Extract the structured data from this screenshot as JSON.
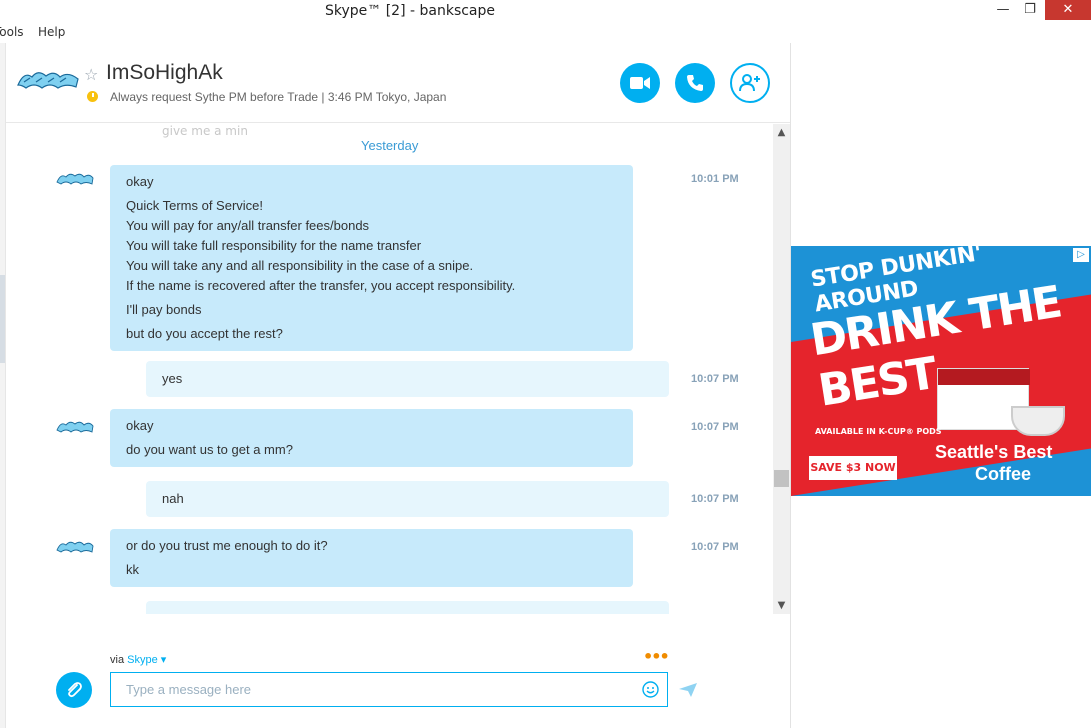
{
  "window": {
    "title": "Skype™ [2] - bankscape",
    "minimize": "—",
    "maximize": "❐",
    "close": "✕"
  },
  "menu": {
    "items": [
      "Tools",
      "Help"
    ]
  },
  "contact": {
    "name": "ImSoHighAk",
    "mood": "Always request Sythe PM before Trade  |  3:46 PM Tokyo, Japan"
  },
  "chat": {
    "faded_text": "give me a min",
    "day_label": "Yesterday",
    "messages": [
      {
        "lines": [
          "okay",
          "Quick Terms of Service!",
          "You will pay for any/all transfer fees/bonds",
          "You will take full responsibility for the name transfer",
          "You will take any and all responsibility in the case of a snipe.",
          "If the name is recovered after the transfer, you accept responsibility.",
          "I'll pay bonds",
          "but do you accept the rest?"
        ],
        "time": "10:01 PM"
      },
      {
        "lines": [
          "yes"
        ],
        "time": "10:07 PM"
      },
      {
        "lines": [
          "okay",
          "do you want us to get a mm?"
        ],
        "time": "10:07 PM"
      },
      {
        "lines": [
          "nah"
        ],
        "time": "10:07 PM"
      },
      {
        "lines": [
          "or do you trust me enough to do it?",
          "kk"
        ],
        "time": "10:07 PM"
      }
    ]
  },
  "compose": {
    "via_prefix": "via",
    "via_service": "Skype",
    "typing_dots": "•••",
    "placeholder": "Type a message here"
  },
  "ad": {
    "line1": "STOP DUNKIN' AROUND",
    "line2": "DRINK THE BEST",
    "available": "AVAILABLE IN K-CUP® PODS",
    "cta": "SAVE $3 NOW",
    "brand_line1": "Seattle's Best",
    "brand_line2": "Coffee"
  },
  "colors": {
    "accent": "#00aff0",
    "bubble_in": "#c7eafb",
    "bubble_out": "#e6f6fd",
    "ad_blue": "#1d92d6",
    "ad_red": "#e5242c"
  }
}
